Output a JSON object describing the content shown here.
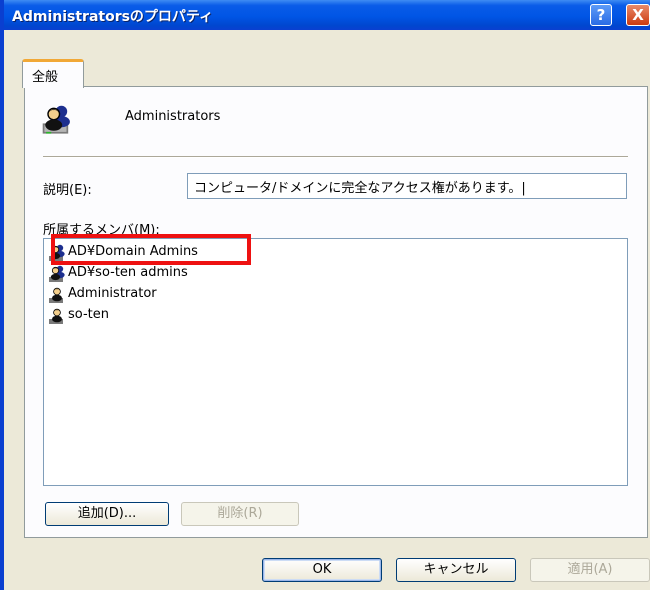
{
  "window": {
    "title": "Administratorsのプロパティ",
    "help_glyph": "?",
    "close_glyph": "X"
  },
  "tabs": [
    {
      "label": "全般",
      "selected": true
    }
  ],
  "general": {
    "group_name": "Administrators",
    "description_label": "説明(E):",
    "description_value": "コンピュータ/ドメインに完全なアクセス権があります。|",
    "members_label": "所属するメンバ(M):",
    "members": [
      {
        "name": "AD¥Domain Admins",
        "icon": "domain-group-icon",
        "highlighted": true
      },
      {
        "name": "AD¥so-ten admins",
        "icon": "domain-group-icon",
        "highlighted": false
      },
      {
        "name": "Administrator",
        "icon": "user-icon",
        "highlighted": false
      },
      {
        "name": "so-ten",
        "icon": "user-icon",
        "highlighted": false
      }
    ],
    "add_button": "追加(D)...",
    "remove_button": "削除(R)"
  },
  "footer": {
    "ok_button": "OK",
    "cancel_button": "キャンセル",
    "apply_button": "適用(A)"
  },
  "colors": {
    "titlebar": "#0055e5",
    "dialog_bg": "#ece9d8",
    "tab_accent": "#f1a836",
    "highlight": "#ee1111"
  }
}
